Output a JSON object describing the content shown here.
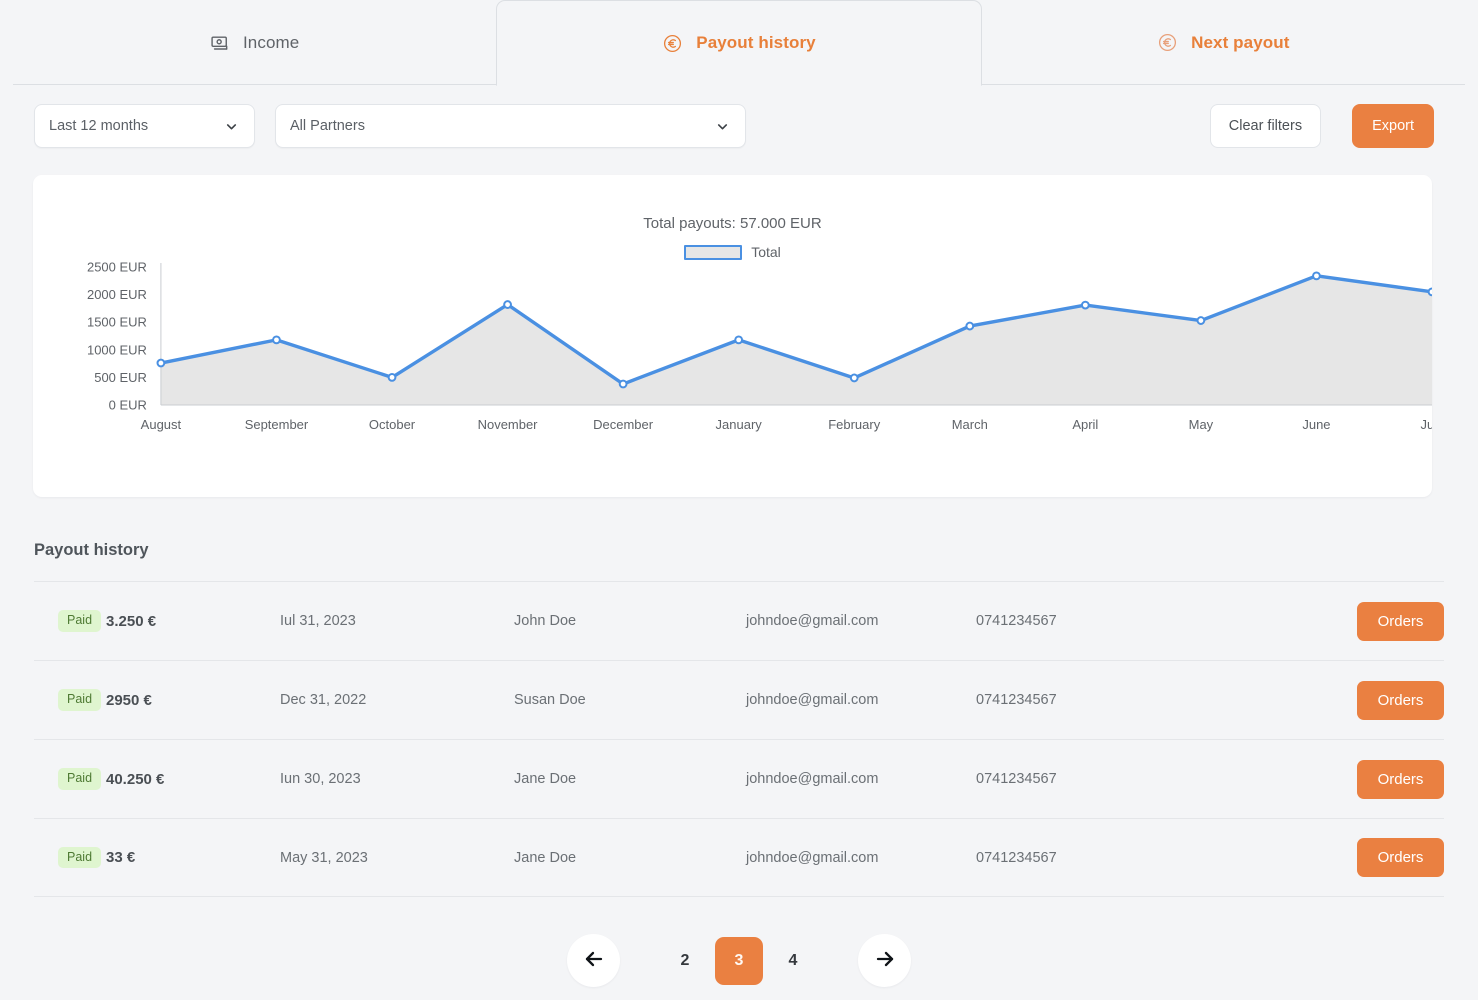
{
  "tabs": [
    {
      "label": "Income",
      "icon": "banknote-icon",
      "active": false,
      "accent": false
    },
    {
      "label": "Payout history",
      "icon": "euro-circle-icon",
      "active": true,
      "accent": true
    },
    {
      "label": "Next payout",
      "icon": "euro-circle-icon",
      "active": false,
      "accent": true
    }
  ],
  "filters": {
    "period": {
      "value": "Last 12 months"
    },
    "partner": {
      "value": "All Partners"
    },
    "clear_label": "Clear filters",
    "export_label": "Export"
  },
  "colors": {
    "accent": "#ea8041",
    "line": "#4a90e2",
    "area": "#e6e6e6",
    "badge_bg": "#dff5cf",
    "badge_text": "#4e7a33",
    "page_bg": "#f4f5f7"
  },
  "chart_data": {
    "type": "area",
    "title": "Total payouts: 57.000 EUR",
    "legend": [
      {
        "name": "Total"
      }
    ],
    "legend_position": "top-center",
    "grid": false,
    "xlabel": "",
    "ylabel": "",
    "ylim": [
      0,
      2500
    ],
    "yticks": [
      0,
      500,
      1000,
      1500,
      2000,
      2500
    ],
    "ytick_labels": [
      "0 EUR",
      "500 EUR",
      "1000 EUR",
      "1500 EUR",
      "2000 EUR",
      "2500 EUR"
    ],
    "categories": [
      "August",
      "September",
      "October",
      "November",
      "December",
      "January",
      "February",
      "March",
      "April",
      "May",
      "June",
      "July"
    ],
    "series": [
      {
        "name": "Total",
        "values": [
          760,
          1180,
          500,
          1820,
          380,
          1180,
          490,
          1430,
          1810,
          1530,
          2340,
          2050
        ]
      }
    ]
  },
  "table": {
    "title": "Payout history",
    "rows": [
      {
        "status": "Paid",
        "amount": "3.250 €",
        "date": "Iul 31, 2023",
        "name": "John Doe",
        "email": "johndoe@gmail.com",
        "phone": "0741234567",
        "action": "Orders"
      },
      {
        "status": "Paid",
        "amount": "2950 €",
        "date": "Dec 31, 2022",
        "name": "Susan Doe",
        "email": "johndoe@gmail.com",
        "phone": "0741234567",
        "action": "Orders"
      },
      {
        "status": "Paid",
        "amount": "40.250 €",
        "date": "Iun 30, 2023",
        "name": "Jane Doe",
        "email": "johndoe@gmail.com",
        "phone": "0741234567",
        "action": "Orders"
      },
      {
        "status": "Paid",
        "amount": "33 €",
        "date": "May 31, 2023",
        "name": "Jane Doe",
        "email": "johndoe@gmail.com",
        "phone": "0741234567",
        "action": "Orders"
      }
    ]
  },
  "pagination": {
    "prev_icon": "arrow-left-icon",
    "next_icon": "arrow-right-icon",
    "pages": [
      "2",
      "3",
      "4"
    ],
    "current": "3"
  }
}
